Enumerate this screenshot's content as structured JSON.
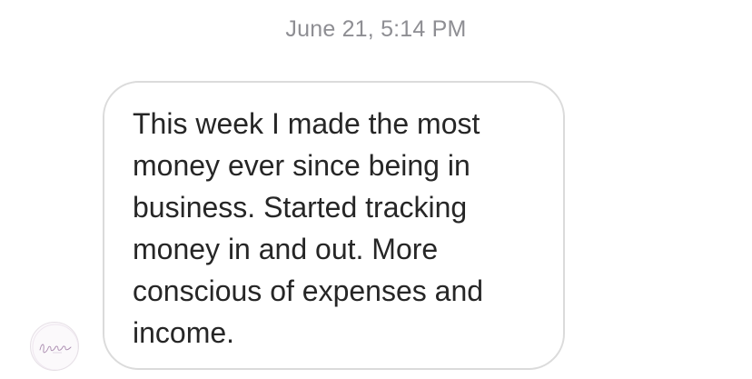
{
  "conversation": {
    "timestamp": "June 21, 5:14 PM",
    "messages": [
      {
        "sender": "incoming",
        "text": "This week I made the most\nmoney ever since being in\nbusiness.  Started tracking\nmoney in and out.  More\nconscious of expenses and\nincome."
      }
    ]
  },
  "sender_avatar": {
    "icon": "script-logo-avatar",
    "logo_text": "Inspiration",
    "accent_color": "#b49ab8"
  },
  "colors": {
    "background": "#ffffff",
    "timestamp": "#8e8e93",
    "bubble_border": "#dbdbdb",
    "message_text": "#262626"
  }
}
